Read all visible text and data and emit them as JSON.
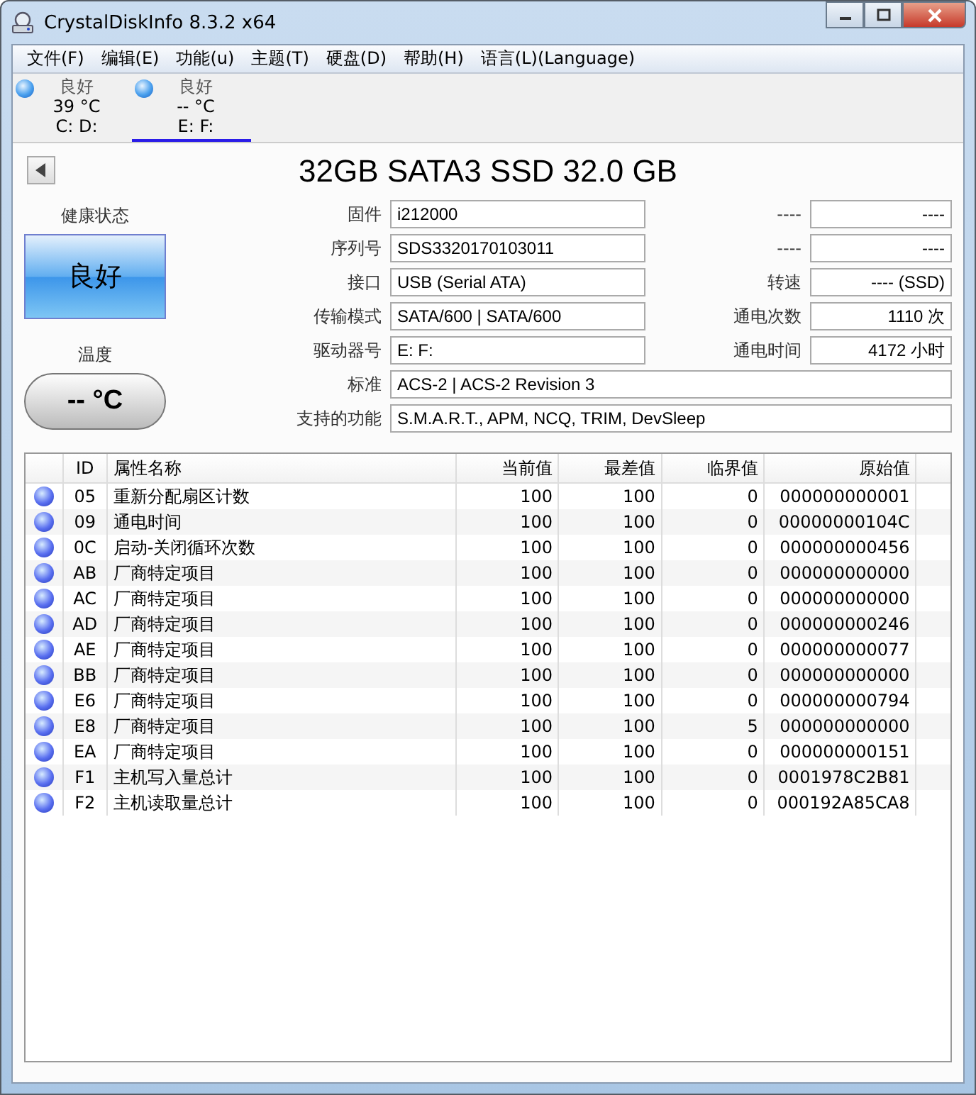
{
  "window": {
    "title": "CrystalDiskInfo 8.3.2 x64"
  },
  "menu": [
    "文件(F)",
    "编辑(E)",
    "功能(u)",
    "主题(T)",
    "硬盘(D)",
    "帮助(H)",
    "语言(L)(Language)"
  ],
  "disks": [
    {
      "health": "良好",
      "temperature": "39 °C",
      "drives": "C: D:",
      "selected": false
    },
    {
      "health": "良好",
      "temperature": "-- °C",
      "drives": "E: F:",
      "selected": true
    }
  ],
  "model": "32GB SATA3 SSD 32.0 GB",
  "health": {
    "label": "健康状态",
    "value": "良好"
  },
  "temperature": {
    "label": "温度",
    "value": "-- °C"
  },
  "info": [
    {
      "label": "固件",
      "value": "i212000",
      "right_label": "----",
      "right_value": "----"
    },
    {
      "label": "序列号",
      "value": "SDS3320170103011",
      "right_label": "----",
      "right_value": "----"
    },
    {
      "label": "接口",
      "value": "USB (Serial ATA)",
      "right_label": "转速",
      "right_value": "---- (SSD)"
    },
    {
      "label": "传输模式",
      "value": "SATA/600 | SATA/600",
      "right_label": "通电次数",
      "right_value": "1110 次"
    },
    {
      "label": "驱动器号",
      "value": "E: F:",
      "right_label": "通电时间",
      "right_value": "4172 小时"
    },
    {
      "label": "标准",
      "value": "ACS-2 | ACS-2 Revision 3"
    },
    {
      "label": "支持的功能",
      "value": "S.M.A.R.T., APM, NCQ, TRIM, DevSleep"
    }
  ],
  "table": {
    "columns": [
      "ID",
      "属性名称",
      "当前值",
      "最差值",
      "临界值",
      "原始值"
    ],
    "rows": [
      [
        "05",
        "重新分配扇区计数",
        "100",
        "100",
        "0",
        "000000000001"
      ],
      [
        "09",
        "通电时间",
        "100",
        "100",
        "0",
        "00000000104C"
      ],
      [
        "0C",
        "启动-关闭循环次数",
        "100",
        "100",
        "0",
        "000000000456"
      ],
      [
        "AB",
        "厂商特定项目",
        "100",
        "100",
        "0",
        "000000000000"
      ],
      [
        "AC",
        "厂商特定项目",
        "100",
        "100",
        "0",
        "000000000000"
      ],
      [
        "AD",
        "厂商特定项目",
        "100",
        "100",
        "0",
        "000000000246"
      ],
      [
        "AE",
        "厂商特定项目",
        "100",
        "100",
        "0",
        "000000000077"
      ],
      [
        "BB",
        "厂商特定项目",
        "100",
        "100",
        "0",
        "000000000000"
      ],
      [
        "E6",
        "厂商特定项目",
        "100",
        "100",
        "0",
        "000000000794"
      ],
      [
        "E8",
        "厂商特定项目",
        "100",
        "100",
        "5",
        "000000000000"
      ],
      [
        "EA",
        "厂商特定项目",
        "100",
        "100",
        "0",
        "000000000151"
      ],
      [
        "F1",
        "主机写入量总计",
        "100",
        "100",
        "0",
        "0001978C2B81"
      ],
      [
        "F2",
        "主机读取量总计",
        "100",
        "100",
        "0",
        "000192A85CA8"
      ]
    ]
  }
}
